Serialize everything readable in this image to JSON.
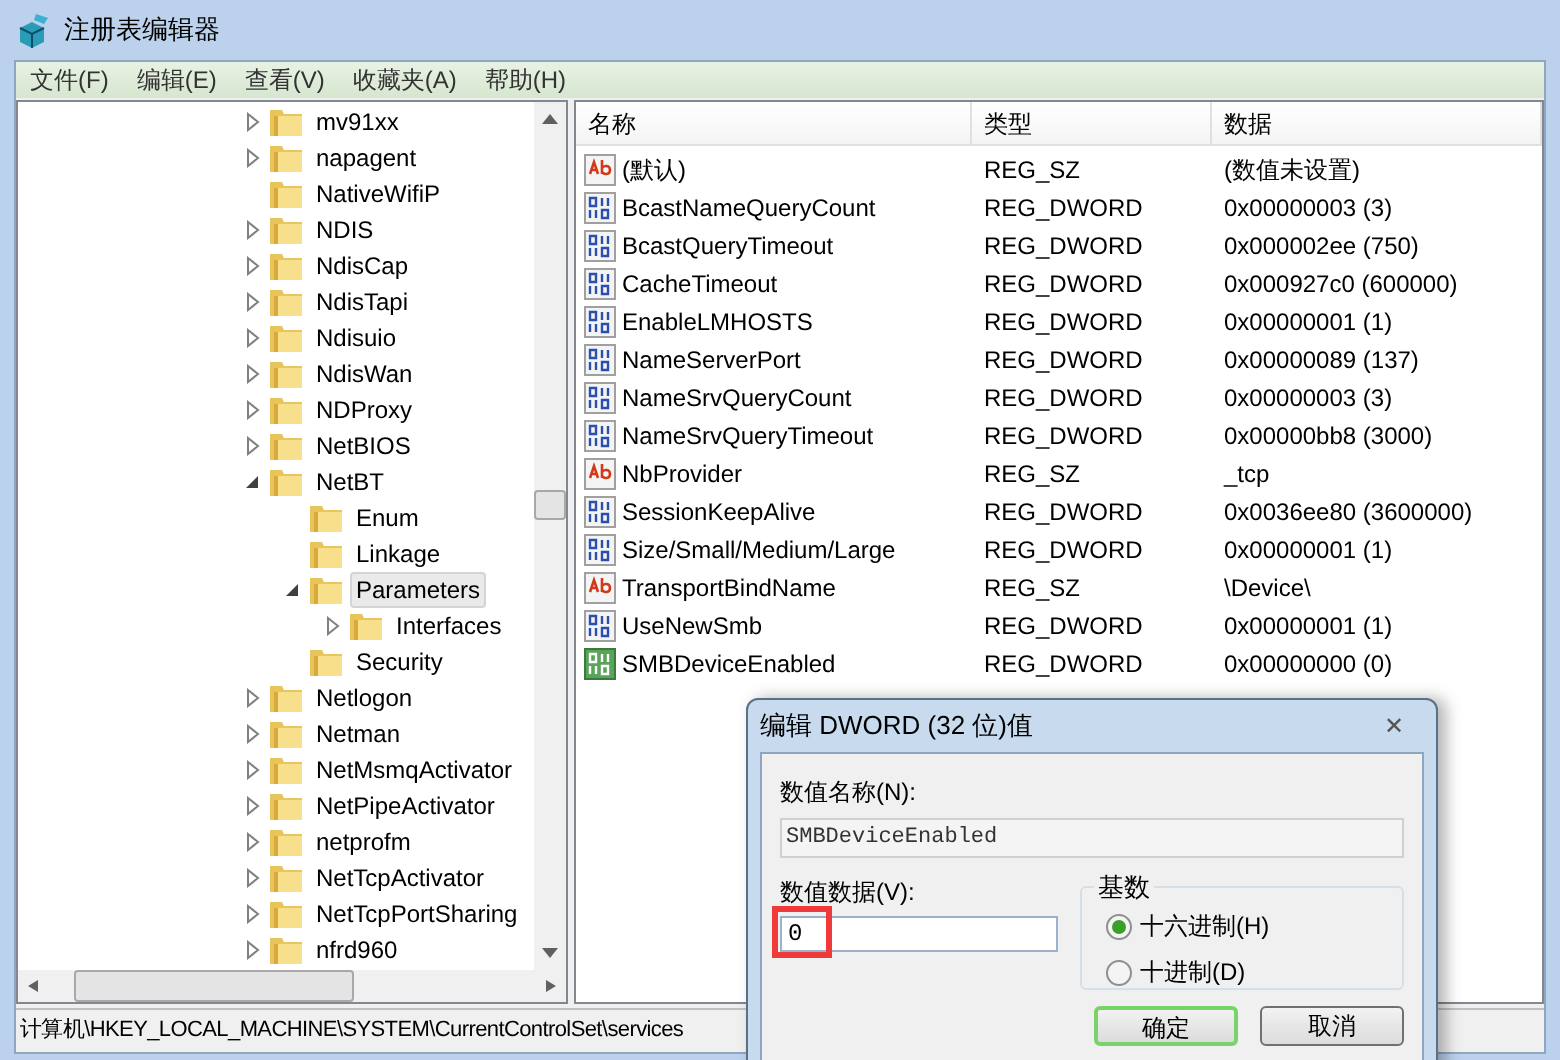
{
  "window": {
    "title": "注册表编辑器"
  },
  "menu": [
    "文件(F)",
    "编辑(E)",
    "查看(V)",
    "收藏夹(A)",
    "帮助(H)"
  ],
  "tree": [
    {
      "label": "mv91xx",
      "expanded": false,
      "selected": false
    },
    {
      "label": "napagent",
      "expanded": false,
      "selected": false
    },
    {
      "label": "NativeWifiP",
      "selected": false
    },
    {
      "label": "NDIS",
      "expanded": false,
      "selected": false
    },
    {
      "label": "NdisCap",
      "expanded": false,
      "selected": false
    },
    {
      "label": "NdisTapi",
      "expanded": false,
      "selected": false
    },
    {
      "label": "Ndisuio",
      "expanded": false,
      "selected": false
    },
    {
      "label": "NdisWan",
      "expanded": false,
      "selected": false
    },
    {
      "label": "NDProxy",
      "expanded": false,
      "selected": false
    },
    {
      "label": "NetBIOS",
      "expanded": false,
      "selected": false
    },
    {
      "label": "NetBT",
      "expanded": true,
      "selected": false,
      "children": [
        {
          "label": "Enum",
          "selected": false
        },
        {
          "label": "Linkage",
          "selected": false
        },
        {
          "label": "Parameters",
          "expanded": true,
          "selected": true,
          "children": [
            {
              "label": "Interfaces",
              "expanded": false,
              "selected": false
            }
          ]
        },
        {
          "label": "Security",
          "selected": false
        }
      ]
    },
    {
      "label": "Netlogon",
      "expanded": false,
      "selected": false
    },
    {
      "label": "Netman",
      "expanded": false,
      "selected": false
    },
    {
      "label": "NetMsmqActivator",
      "expanded": false,
      "selected": false
    },
    {
      "label": "NetPipeActivator",
      "expanded": false,
      "selected": false
    },
    {
      "label": "netprofm",
      "expanded": false,
      "selected": false
    },
    {
      "label": "NetTcpActivator",
      "expanded": false,
      "selected": false
    },
    {
      "label": "NetTcpPortSharing",
      "expanded": false,
      "selected": false
    },
    {
      "label": "nfrd960",
      "expanded": false,
      "selected": false
    }
  ],
  "table": {
    "columns": [
      "名称",
      "类型",
      "数据"
    ],
    "rows": [
      {
        "kind": "string",
        "name": "(默认)",
        "type": "REG_SZ",
        "data": "(数值未设置)",
        "selected": false
      },
      {
        "kind": "dword",
        "name": "BcastNameQueryCount",
        "type": "REG_DWORD",
        "data": "0x00000003 (3)",
        "selected": false
      },
      {
        "kind": "dword",
        "name": "BcastQueryTimeout",
        "type": "REG_DWORD",
        "data": "0x000002ee (750)",
        "selected": false
      },
      {
        "kind": "dword",
        "name": "CacheTimeout",
        "type": "REG_DWORD",
        "data": "0x000927c0 (600000)",
        "selected": false
      },
      {
        "kind": "dword",
        "name": "EnableLMHOSTS",
        "type": "REG_DWORD",
        "data": "0x00000001 (1)",
        "selected": false
      },
      {
        "kind": "dword",
        "name": "NameServerPort",
        "type": "REG_DWORD",
        "data": "0x00000089 (137)",
        "selected": false
      },
      {
        "kind": "dword",
        "name": "NameSrvQueryCount",
        "type": "REG_DWORD",
        "data": "0x00000003 (3)",
        "selected": false
      },
      {
        "kind": "dword",
        "name": "NameSrvQueryTimeout",
        "type": "REG_DWORD",
        "data": "0x00000bb8 (3000)",
        "selected": false
      },
      {
        "kind": "string",
        "name": "NbProvider",
        "type": "REG_SZ",
        "data": "_tcp",
        "selected": false
      },
      {
        "kind": "dword",
        "name": "SessionKeepAlive",
        "type": "REG_DWORD",
        "data": "0x0036ee80 (3600000)",
        "selected": false
      },
      {
        "kind": "dword",
        "name": "Size/Small/Medium/Large",
        "type": "REG_DWORD",
        "data": "0x00000001 (1)",
        "selected": false
      },
      {
        "kind": "string",
        "name": "TransportBindName",
        "type": "REG_SZ",
        "data": "\\Device\\",
        "selected": false
      },
      {
        "kind": "dword",
        "name": "UseNewSmb",
        "type": "REG_DWORD",
        "data": "0x00000001 (1)",
        "selected": false
      },
      {
        "kind": "dword",
        "name": "SMBDeviceEnabled",
        "type": "REG_DWORD",
        "data": "0x00000000 (0)",
        "selected": true
      }
    ]
  },
  "status_bar": "计算机\\HKEY_LOCAL_MACHINE\\SYSTEM\\CurrentControlSet\\services",
  "dialog": {
    "title": "编辑 DWORD (32 位)值",
    "close": "✕",
    "name_label": "数值名称(N):",
    "name_value": "SMBDeviceEnabled",
    "data_label": "数值数据(V):",
    "data_value": "0",
    "data_highlighted": true,
    "base_label": "基数",
    "radios": [
      {
        "label": "十六进制(H)",
        "selected": true
      },
      {
        "label": "十进制(D)",
        "selected": false
      }
    ],
    "buttons": [
      {
        "label": "确定",
        "default": true
      },
      {
        "label": "取消",
        "default": false
      }
    ]
  }
}
